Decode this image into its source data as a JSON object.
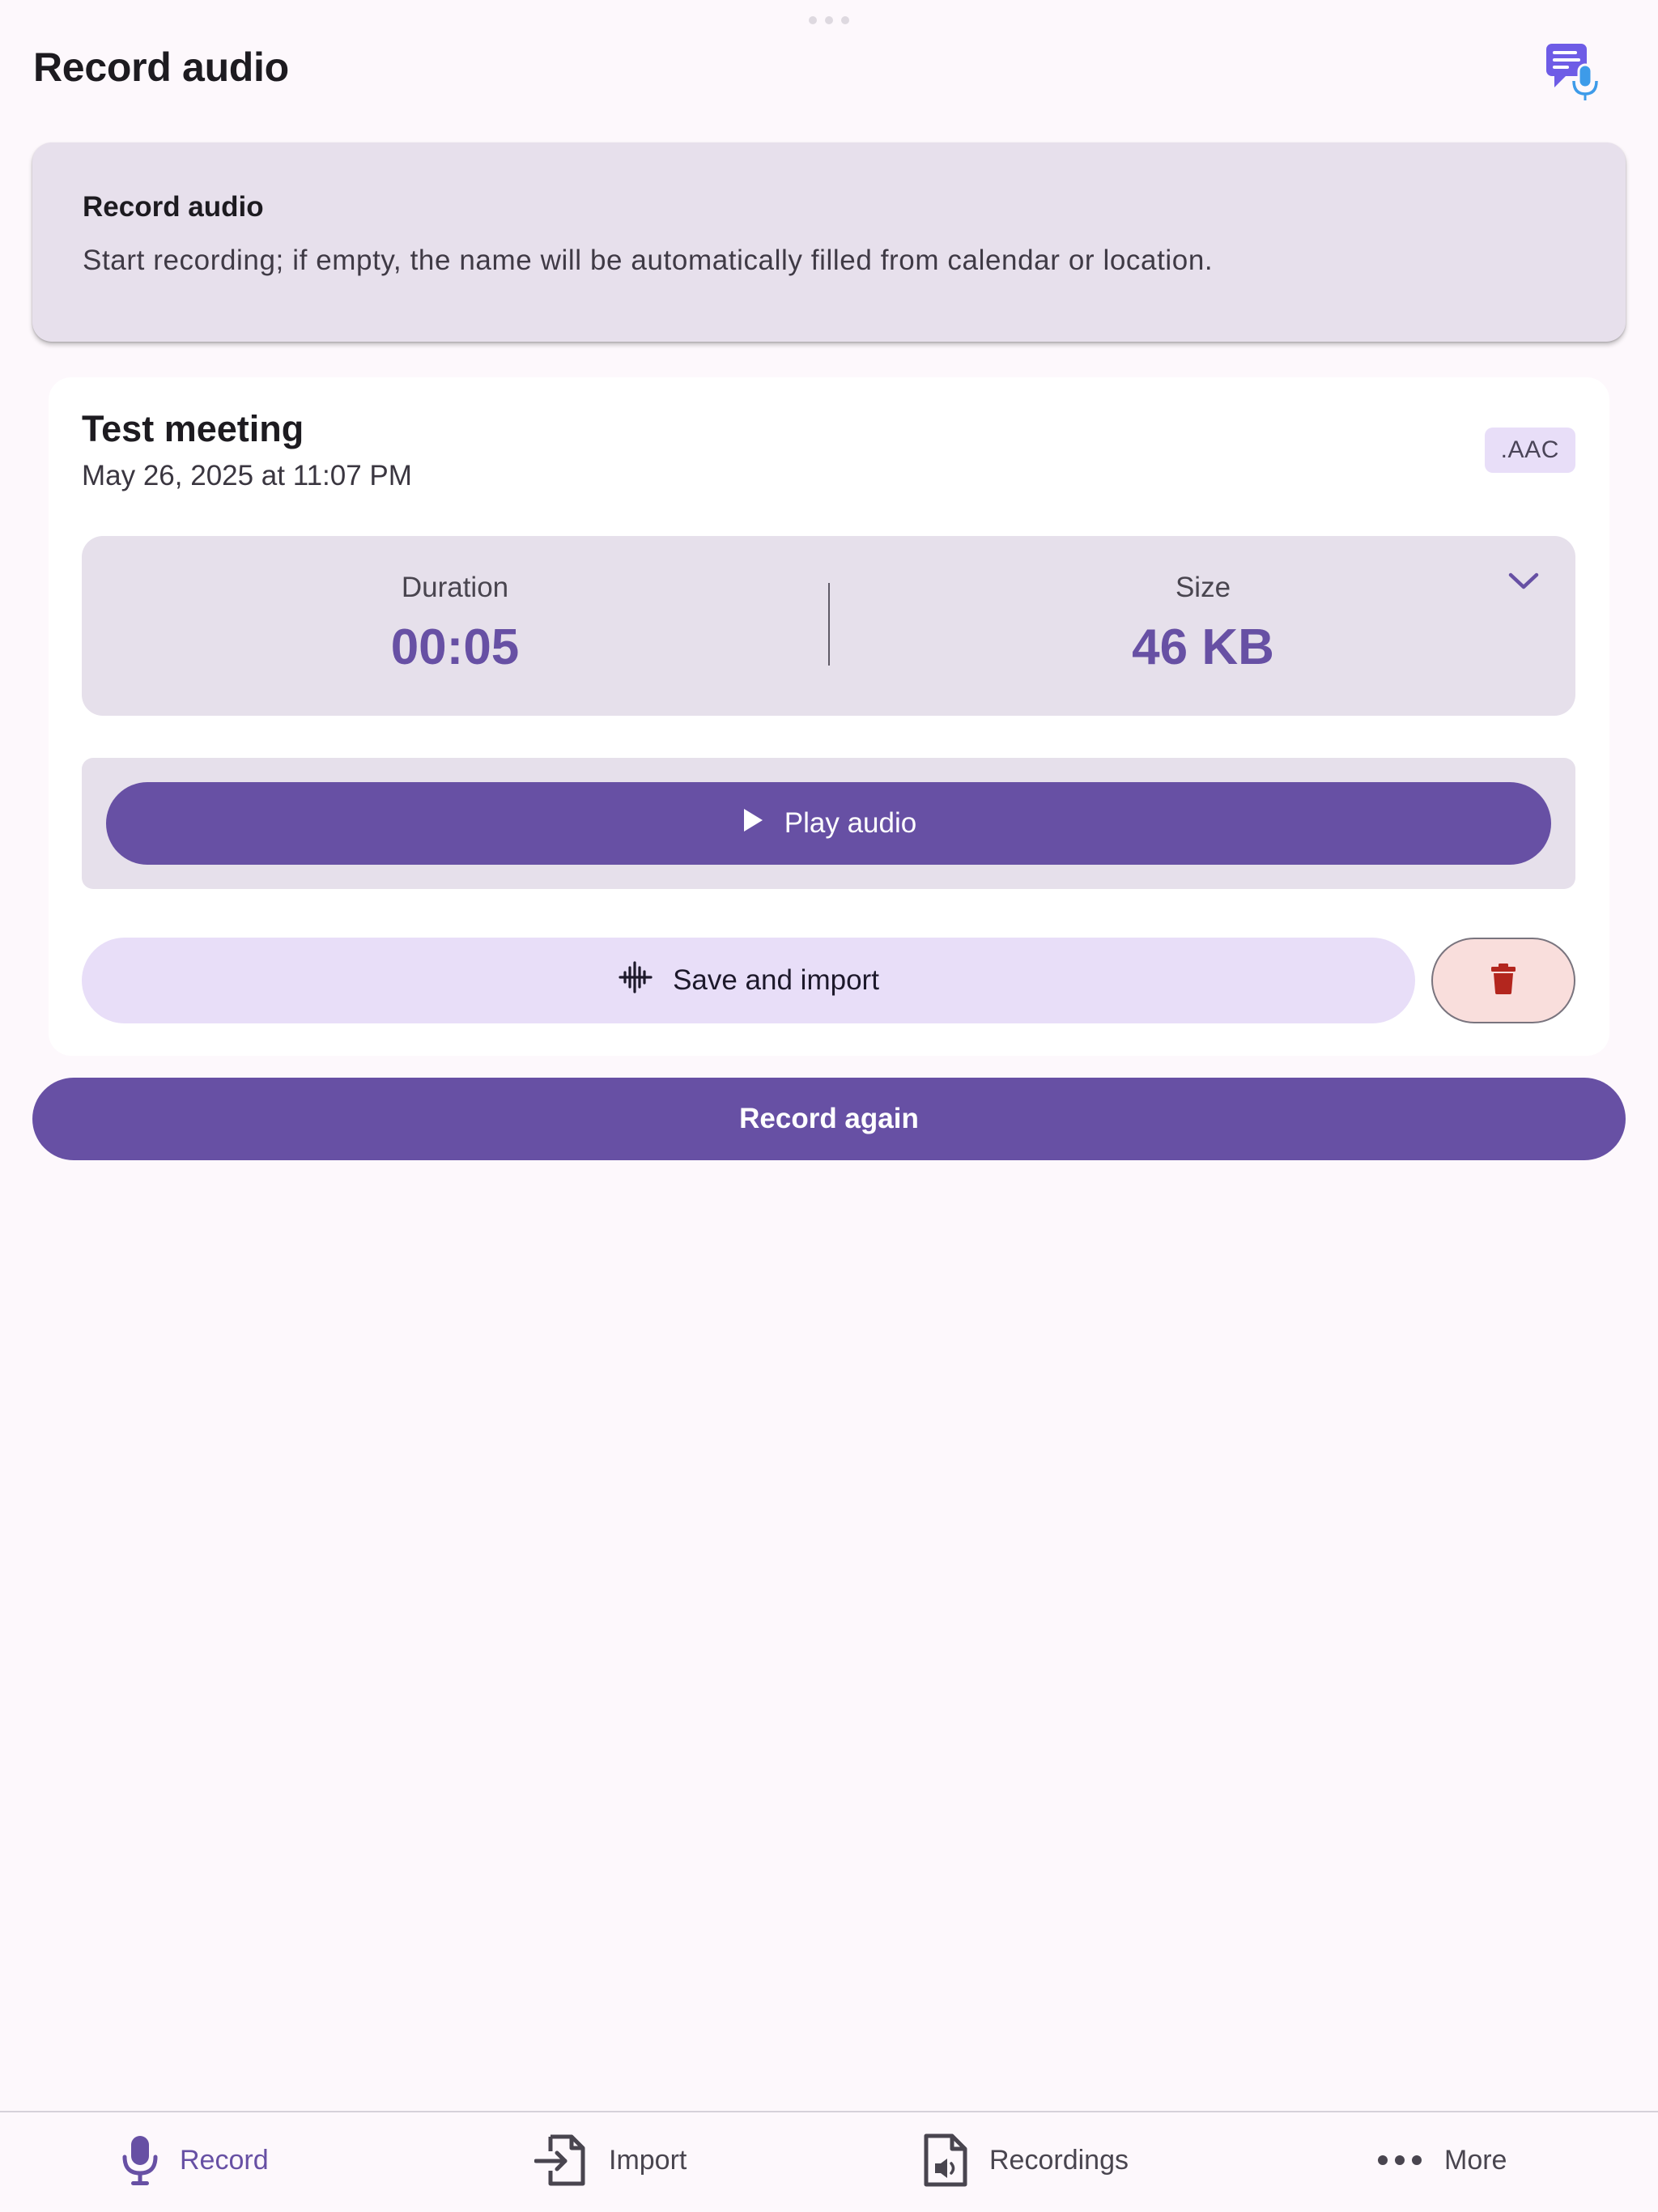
{
  "header": {
    "title": "Record audio"
  },
  "info_card": {
    "title": "Record audio",
    "description": "Start recording; if empty, the name will be automatically filled from calendar or location."
  },
  "recording": {
    "name": "Test meeting",
    "date": "May 26, 2025 at 11:07 PM",
    "format_badge": ".AAC",
    "duration_label": "Duration",
    "duration_value": "00:05",
    "size_label": "Size",
    "size_value": "46 KB",
    "play_label": "Play audio",
    "save_label": "Save and import"
  },
  "record_again_label": "Record again",
  "nav": {
    "items": [
      {
        "label": "Record",
        "icon": "mic-icon",
        "active": true
      },
      {
        "label": "Import",
        "icon": "import-icon",
        "active": false
      },
      {
        "label": "Recordings",
        "icon": "audio-file-icon",
        "active": false
      },
      {
        "label": "More",
        "icon": "more-icon",
        "active": false
      }
    ]
  },
  "colors": {
    "primary": "#6750a4",
    "surface_variant": "#e7e0ec",
    "secondary_container": "#e8def8",
    "error_container": "#f9dedc",
    "error": "#b3261e",
    "background": "#fdf8fc"
  }
}
